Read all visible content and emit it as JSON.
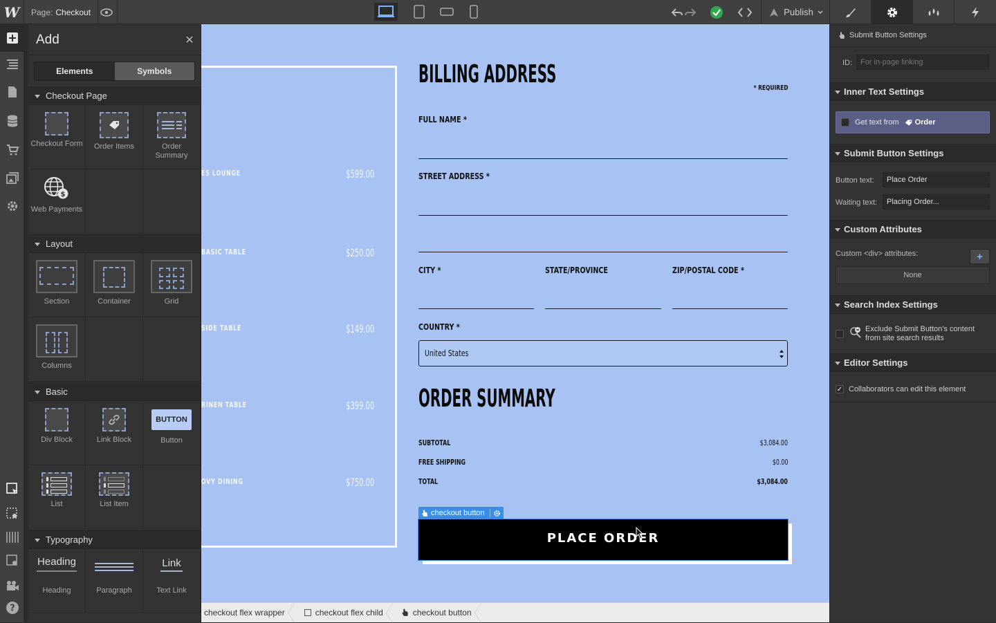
{
  "topbar": {
    "logo": "W",
    "page_label": "Page:",
    "page_name": "Checkout",
    "publish": "Publish"
  },
  "add_panel": {
    "title": "Add",
    "tabs": [
      "Elements",
      "Symbols"
    ],
    "sections": [
      {
        "title": "Checkout Page",
        "items": [
          "Checkout Form",
          "Order Items",
          "Order Summary",
          "Web Payments"
        ]
      },
      {
        "title": "Layout",
        "items": [
          "Section",
          "Container",
          "Grid",
          "Columns"
        ]
      },
      {
        "title": "Basic",
        "items": [
          "Div Block",
          "Link Block",
          "Button",
          "List",
          "List Item"
        ]
      },
      {
        "title": "Typography",
        "items": [
          "Heading",
          "Paragraph",
          "Text Link"
        ]
      }
    ],
    "button_preview": "BUTTON",
    "heading_preview": "Heading",
    "link_preview": "Link"
  },
  "canvas": {
    "items": [
      {
        "name": "ES LOUNGE",
        "price": "$599.00"
      },
      {
        "name": "BASIC TABLE",
        "price": "$250.00"
      },
      {
        "name": "SIDE TABLE",
        "price": "$149.00"
      },
      {
        "name": "RINEN TABLE",
        "price": "$399.00"
      },
      {
        "name": "OVY DINING",
        "price": "$750.00"
      }
    ],
    "billing_title": "BILLING ADDRESS",
    "required_note": "* REQUIRED",
    "full_name_label": "FULL NAME *",
    "street_label": "STREET ADDRESS *",
    "city_label": "CITY *",
    "state_label": "STATE/PROVINCE",
    "zip_label": "ZIP/POSTAL CODE *",
    "country_label": "COUNTRY *",
    "country_value": "United States",
    "summary_title": "ORDER SUMMARY",
    "summary": [
      {
        "label": "SUBTOTAL",
        "value": "$3,084.00"
      },
      {
        "label": "FREE SHIPPING",
        "value": "$0.00"
      },
      {
        "label": "TOTAL",
        "value": "$3,084.00"
      }
    ],
    "selected_tag": "checkout button",
    "place_order": "PLACE ORDER"
  },
  "breadcrumbs": [
    "checkout flex wrapper",
    "checkout flex child",
    "checkout button"
  ],
  "right_panel": {
    "top_title": "Submit Button Settings",
    "id_label": "ID:",
    "id_placeholder": "For in-page linking",
    "inner_text_title": "Inner Text Settings",
    "get_text_from": "Get text from",
    "get_text_source": "Order",
    "submit_title": "Submit Button Settings",
    "button_text_label": "Button text:",
    "button_text_value": "Place Order",
    "waiting_text_label": "Waiting text:",
    "waiting_text_value": "Placing Order...",
    "custom_attr_title": "Custom Attributes",
    "custom_attr_label": "Custom <div> attributes:",
    "custom_attr_none": "None",
    "search_title": "Search Index Settings",
    "search_exclude": "Exclude Submit Button's content from site search results",
    "editor_title": "Editor Settings",
    "editor_collab": "Collaborators can edit this element"
  },
  "colors": {
    "canvas_bg": "#a8c3f3",
    "selection": "#3a8ee6",
    "publish_ok": "#2fa84f"
  }
}
